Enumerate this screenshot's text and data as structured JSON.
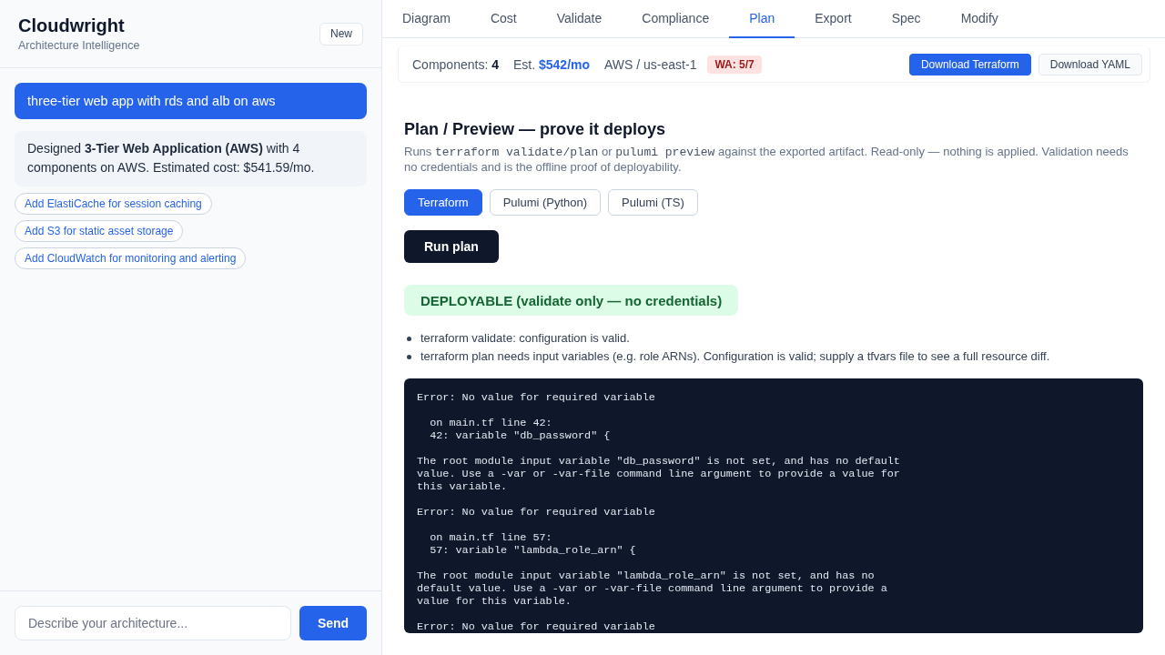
{
  "sidebar": {
    "brand": {
      "title": "Cloudwright",
      "subtitle": "Architecture Intelligence"
    },
    "new_button": "New",
    "messages": [
      {
        "kind": "user",
        "text": "three-tier web app with rds and alb on aws"
      },
      {
        "kind": "assistant",
        "text": "Designed **3-Tier Web Application (AWS)** with 4 components on AWS. Estimated cost: $541.59/mo."
      }
    ],
    "suggestions": [
      "Add ElastiCache for session caching",
      "Add S3 for static asset storage",
      "Add CloudWatch for monitoring and alerting"
    ],
    "composer": {
      "placeholder": "Describe your architecture...",
      "send_label": "Send"
    }
  },
  "tabs": [
    {
      "label": "Diagram",
      "selected": false
    },
    {
      "label": "Cost",
      "selected": false
    },
    {
      "label": "Validate",
      "selected": false
    },
    {
      "label": "Compliance",
      "selected": false
    },
    {
      "label": "Plan",
      "selected": true
    },
    {
      "label": "Export",
      "selected": false
    },
    {
      "label": "Spec",
      "selected": false
    },
    {
      "label": "Modify",
      "selected": false
    }
  ],
  "summary": {
    "components": "Components: **4**",
    "cost": "Est. **$542/mo**",
    "region": "AWS / us-east-1",
    "badge": "WA: 5/7",
    "buttons": [
      {
        "label": "Download Terraform",
        "kind": "primary"
      },
      {
        "label": "Download YAML",
        "kind": "secondary"
      }
    ]
  },
  "plan": {
    "title": "Plan / Preview — prove it deploys",
    "description": [
      {
        "kind": "text",
        "text": "Runs "
      },
      {
        "kind": "code",
        "text": "terraform validate/plan"
      },
      {
        "kind": "text",
        "text": " or "
      },
      {
        "kind": "code",
        "text": "pulumi preview"
      },
      {
        "kind": "text",
        "text": " against the exported artifact. Read-only — nothing is applied. Validation needs no credentials and is the offline proof of deployability."
      }
    ],
    "engines": [
      {
        "label": "Terraform",
        "selected": true
      },
      {
        "label": "Pulumi (Python)",
        "selected": false
      },
      {
        "label": "Pulumi (TS)",
        "selected": false
      }
    ],
    "run_button": "Run plan",
    "status": {
      "kind": "success",
      "text": "DEPLOYABLE (validate only — no credentials)"
    },
    "notes": [
      "terraform validate: configuration is valid.",
      "terraform plan needs input variables (e.g. role ARNs). Configuration is valid; supply a tfvars file to see a full resource diff."
    ],
    "output_blocks": [
      "Error: No value for required variable",
      "  on main.tf line 42:\n  42: variable \"db_password\" {",
      "The root module input variable \"db_password\" is not set, and has no default\nvalue. Use a -var or -var-file command line argument to provide a value for\nthis variable.",
      "Error: No value for required variable",
      "  on main.tf line 57:\n  57: variable \"lambda_role_arn\" {",
      "The root module input variable \"lambda_role_arn\" is not set, and has no\ndefault value. Use a -var or -var-file command line argument to provide a\nvalue for this variable.",
      "Error: No value for required variable"
    ]
  }
}
